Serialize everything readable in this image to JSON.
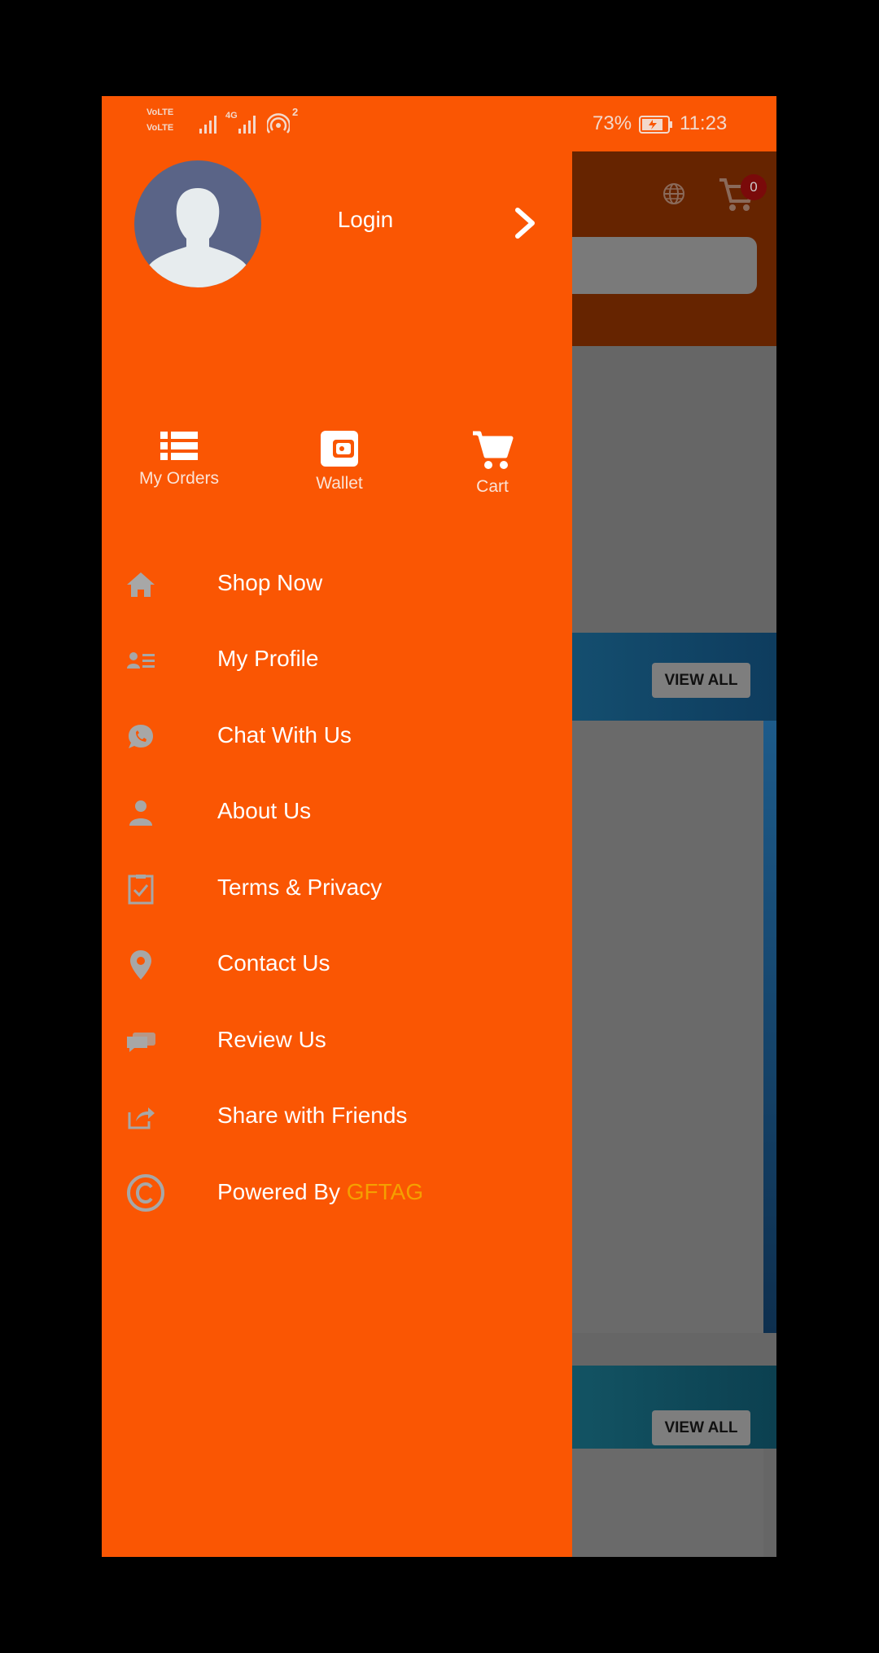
{
  "status_bar": {
    "sim1": "VoLTE",
    "sim2": "VoLTE",
    "network": "4G",
    "hotspot_count": "2",
    "battery": "73%",
    "time": "11:23"
  },
  "background_app": {
    "cart_count": "0",
    "view_all_1": "VIEW ALL",
    "view_all_2": "VIEW ALL"
  },
  "drawer": {
    "login_label": "Login",
    "quick_actions": [
      {
        "label": "My Orders",
        "icon": "list-icon"
      },
      {
        "label": "Wallet",
        "icon": "wallet-icon"
      },
      {
        "label": "Cart",
        "icon": "cart-icon"
      }
    ],
    "menu": [
      {
        "label": "Shop Now",
        "icon": "home-icon"
      },
      {
        "label": "My Profile",
        "icon": "profile-card-icon"
      },
      {
        "label": "Chat With Us",
        "icon": "whatsapp-icon"
      },
      {
        "label": "About Us",
        "icon": "person-icon"
      },
      {
        "label": "Terms & Privacy",
        "icon": "clipboard-check-icon"
      },
      {
        "label": "Contact Us",
        "icon": "location-pin-icon"
      },
      {
        "label": "Review Us",
        "icon": "chat-bubbles-icon"
      },
      {
        "label": "Share with Friends",
        "icon": "share-icon"
      }
    ],
    "powered_by": {
      "prefix": "Powered By ",
      "brand": "GFTAG",
      "icon": "copyright-icon"
    }
  },
  "colors": {
    "drawer_bg": "#FA5603",
    "brand_accent": "#F5A000",
    "icon_muted": "#A7A7A7"
  }
}
